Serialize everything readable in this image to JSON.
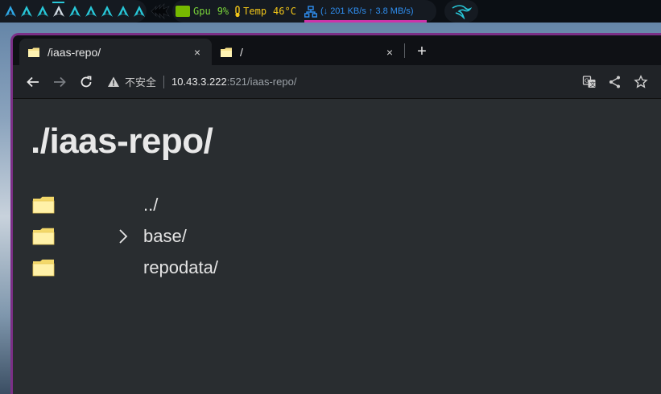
{
  "topbar": {
    "workspaces": [
      {
        "id": 1,
        "active": false
      },
      {
        "id": 2,
        "active": false
      },
      {
        "id": 3,
        "active": false
      },
      {
        "id": 4,
        "active": true
      },
      {
        "id": 5,
        "active": false
      },
      {
        "id": 6,
        "active": false
      },
      {
        "id": 7,
        "active": false
      },
      {
        "id": 8,
        "active": false
      },
      {
        "id": 9,
        "active": false
      }
    ],
    "gpu_label": "Gpu",
    "gpu_value": "9%",
    "temp_label": "Temp",
    "temp_value": "46°C",
    "net_down": "201 KB/s",
    "net_up": "3.8 MB/s"
  },
  "tabs": [
    {
      "title": "/iaas-repo/",
      "active": true
    },
    {
      "title": "/",
      "active": false
    }
  ],
  "tab_close_glyph": "×",
  "new_tab_glyph": "+",
  "address": {
    "insecure_label": "不安全",
    "host": "10.43.3.222",
    "path": ":521/iaas-repo/"
  },
  "page": {
    "heading": "./iaas-repo/",
    "entries": [
      {
        "name": "../",
        "expandable": false
      },
      {
        "name": "base/",
        "expandable": true
      },
      {
        "name": "repodata/",
        "expandable": false
      }
    ]
  },
  "colors": {
    "accent": "#28c7d8",
    "window_border": "#7b2f86",
    "page_bg": "#292d30",
    "gpu": "#7ad43a",
    "temp": "#f0c419",
    "net": "#2f8ef0"
  }
}
